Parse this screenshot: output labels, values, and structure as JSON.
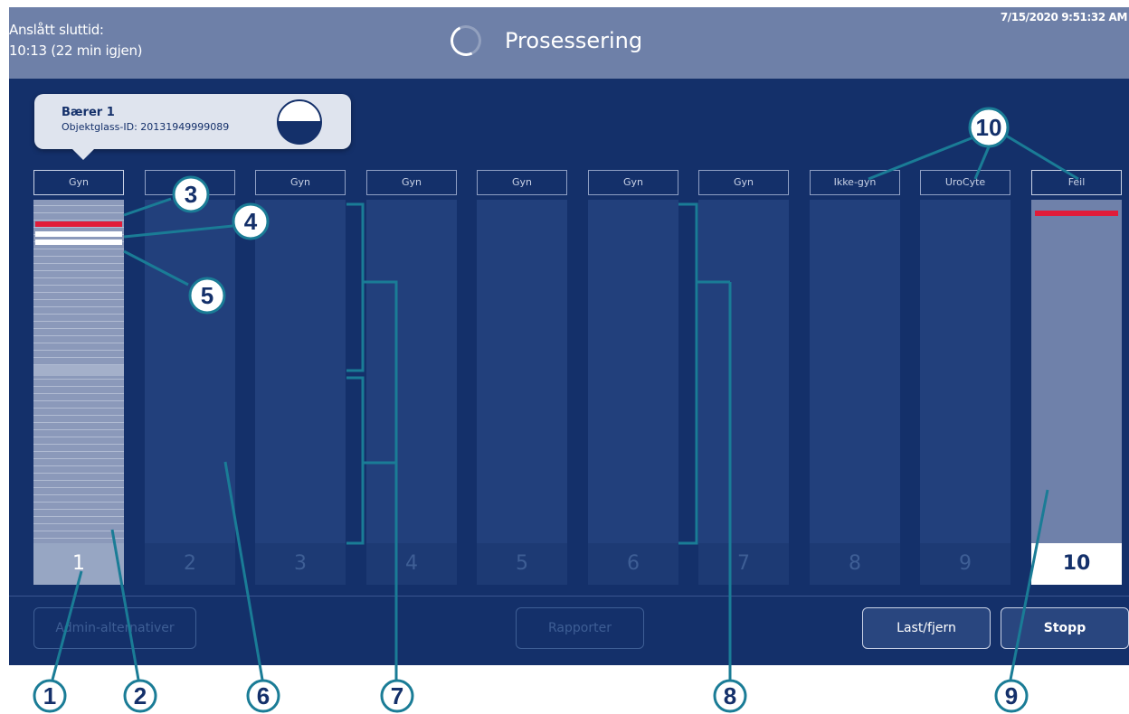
{
  "header": {
    "end_time_label": "Anslått sluttid:",
    "end_time_value": "10:13 (22 min igjen)",
    "title": "Prosessering",
    "timestamp": "7/15/2020 9:51:32 AM"
  },
  "tooltip": {
    "title": "Bærer 1",
    "slide_id": "Objektglass-ID: 20131949999089"
  },
  "columns": [
    {
      "label": "Gyn",
      "number": "1"
    },
    {
      "label": "",
      "number": "2"
    },
    {
      "label": "Gyn",
      "number": "3"
    },
    {
      "label": "Gyn",
      "number": "4"
    },
    {
      "label": "Gyn",
      "number": "5"
    },
    {
      "label": "Gyn",
      "number": "6"
    },
    {
      "label": "Gyn",
      "number": "7"
    },
    {
      "label": "Ikke-gyn",
      "number": "8"
    },
    {
      "label": "UroCyte",
      "number": "9"
    },
    {
      "label": "Feil",
      "number": "10"
    }
  ],
  "footer": {
    "admin_button": "Admin-alternativer",
    "reports_button": "Rapporter",
    "load_button": "Last/fjern",
    "stop_button": "Stopp"
  },
  "callouts": [
    "1",
    "2",
    "3",
    "4",
    "5",
    "6",
    "7",
    "8",
    "9",
    "10"
  ],
  "colors": {
    "background": "#14306a",
    "header": "#6e80a8",
    "error": "#e11c3a",
    "callout": "#1a7c96"
  }
}
